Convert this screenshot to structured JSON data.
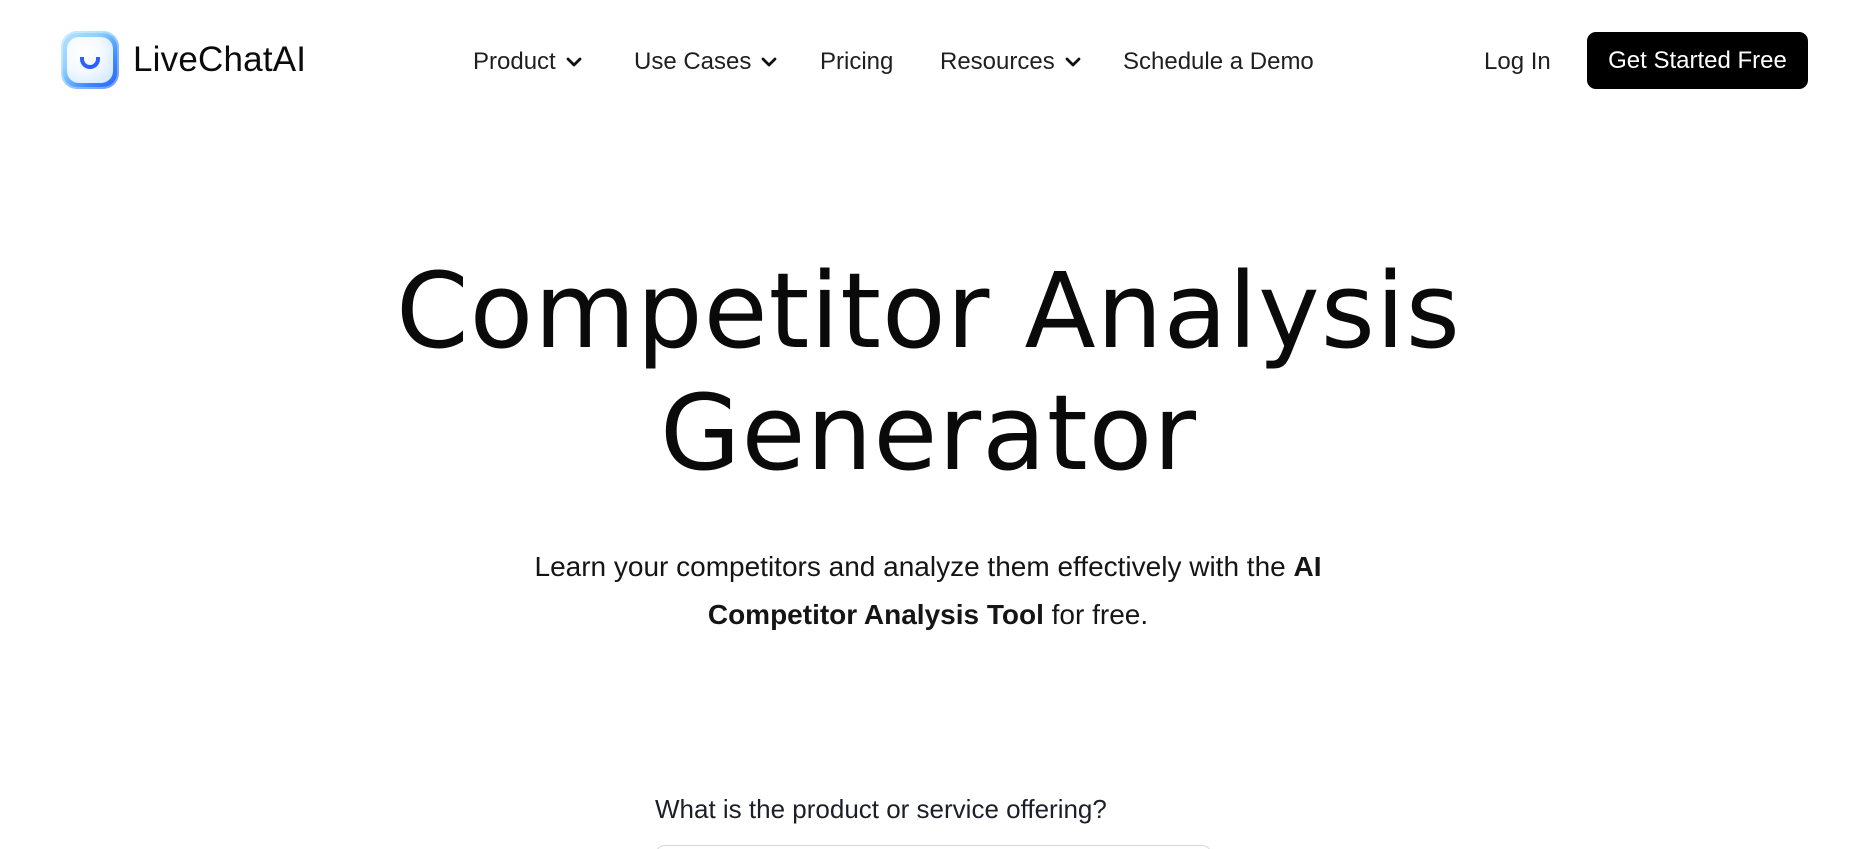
{
  "header": {
    "brand": "LiveChatAI",
    "nav": {
      "product": "Product",
      "use_cases": "Use Cases",
      "pricing": "Pricing",
      "resources": "Resources",
      "schedule_demo": "Schedule a Demo"
    },
    "login": "Log In",
    "cta": "Get Started Free"
  },
  "hero": {
    "title_line1": "Competitor Analysis",
    "title_line2": "Generator",
    "subtitle_part1": "Learn your competitors and analyze them effectively with the ",
    "subtitle_bold": "AI Competitor Analysis Tool",
    "subtitle_part2": " for free."
  },
  "form": {
    "question_label": "What is the product or service offering?"
  },
  "colors": {
    "cta_background": "#000000",
    "cta_text": "#ffffff",
    "logo_accent": "#2a62ff"
  },
  "icons": {
    "logo": "smile-logo-icon",
    "dropdown": "chevron-down-icon"
  }
}
